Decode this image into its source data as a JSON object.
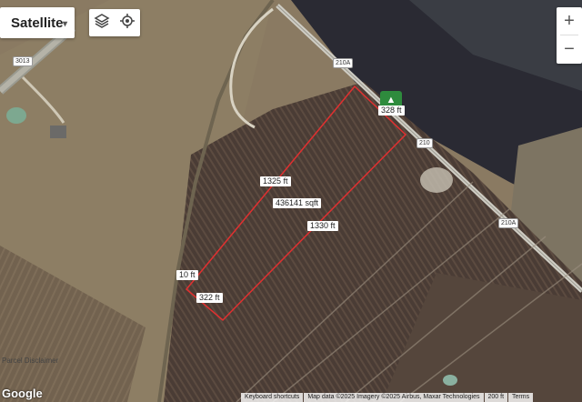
{
  "map_type": {
    "label": "Satellite",
    "caret": "▾"
  },
  "controls": {
    "layers_icon": "layers-icon",
    "locate_icon": "locate-icon",
    "zoom_in": "+",
    "zoom_out": "−"
  },
  "roads": [
    "3013",
    "210A",
    "210",
    "210A"
  ],
  "parcel": {
    "top_edge": "328 ft",
    "left_edge": "1325 ft",
    "area": "436141 sqft",
    "right_edge": "1330 ft",
    "bottom_left": "10 ft",
    "bottom_edge": "322 ft"
  },
  "disclaimer": "Parcel Disclaimer",
  "logo": "Google",
  "footer": [
    "Keyboard shortcuts",
    "Map data ©2025 Imagery ©2025 Airbus, Maxar Technologies",
    "200 ft",
    "Terms"
  ],
  "colors": {
    "parcel_line": "#e03030",
    "pin": "#2e8b3d"
  }
}
